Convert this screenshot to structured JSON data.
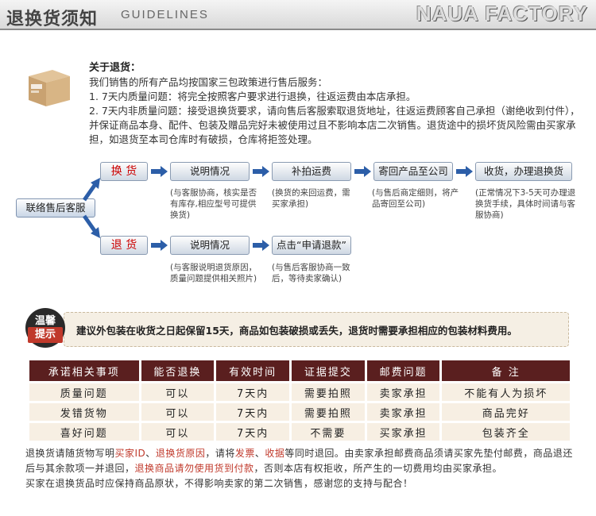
{
  "header": {
    "title_cn": "退换货须知",
    "title_en": "GUIDELINES",
    "brand": "NAUA FACTORY"
  },
  "intro": {
    "title": "关于退货：",
    "line1": "我们销售的所有产品均按国家三包政策进行售后服务：",
    "line2": "1. 7天内质量问题：将完全按照客户要求进行退换，往返运费由本店承担。",
    "line3": "2. 7天内非质量问题：接受退换货要求，请向售后客服索取退货地址，往返运费顾客自己承担（谢绝收到付件），并保证商品本身、配件、包装及赠品完好未被使用过且不影响本店二次销售。退货途中的损坏货风险需由买家承担，如退货至本司仓库时有破损，仓库将拒签处理。"
  },
  "flow": {
    "start": "联络售后客服",
    "exchange": "换 货",
    "return": "退 货",
    "ex_steps": [
      "说明情况",
      "补拍运费",
      "寄回产品至公司",
      "收货，办理退换货"
    ],
    "ex_notes": [
      "(与客服协商，核实是否有库存,相应型号可提供换货)",
      "(换货的来回运费，需买家承担)",
      "(与售后商定细则，将产品寄回至公司)",
      "(正常情况下3-5天可办理退换货手续，具体时间请与客服协商)"
    ],
    "ret_steps": [
      "说明情况",
      "点击“申请退款”"
    ],
    "ret_notes": [
      "(与客服说明退货原因，质量问题提供相关照片)",
      "(与售后客服协商一致后，等待卖家确认)"
    ]
  },
  "tip": {
    "badge_top": "温馨",
    "badge_bottom": "提示",
    "text": "建议外包装在收货之日起保留15天，商品如包装破损或丢失，退货时需要承担相应的包装材料费用。"
  },
  "table": {
    "headers": [
      "承诺相关事项",
      "能否退换",
      "有效时间",
      "证据提交",
      "邮费问题",
      "备  注"
    ],
    "rows": [
      [
        "质量问题",
        "可以",
        "7天内",
        "需要拍照",
        "卖家承担",
        "不能有人为损坏"
      ],
      [
        "发错货物",
        "可以",
        "7天内",
        "需要拍照",
        "卖家承担",
        "商品完好"
      ],
      [
        "喜好问题",
        "可以",
        "7天内",
        "不需要",
        "买家承担",
        "包装齐全"
      ]
    ]
  },
  "footer": {
    "a1": "退换货请随货物写明",
    "a2": "买家ID",
    "a3": "、",
    "a4": "退换货原因",
    "a5": "，请将",
    "a6": "发票",
    "a7": "、",
    "a8": "收据",
    "a9": "等同时退回。由卖家承担邮费商品须请买家先垫付邮费，商品退还后与其余款项一并退回，",
    "a10": "退换商品请勿使用货到付款",
    "a11": "，否则本店有权拒收，所产生的一切费用均由买家承担。",
    "b": "买家在退换货品时应保持商品原状，不得影响卖家的第二次销售，感谢您的支持与配合！"
  }
}
